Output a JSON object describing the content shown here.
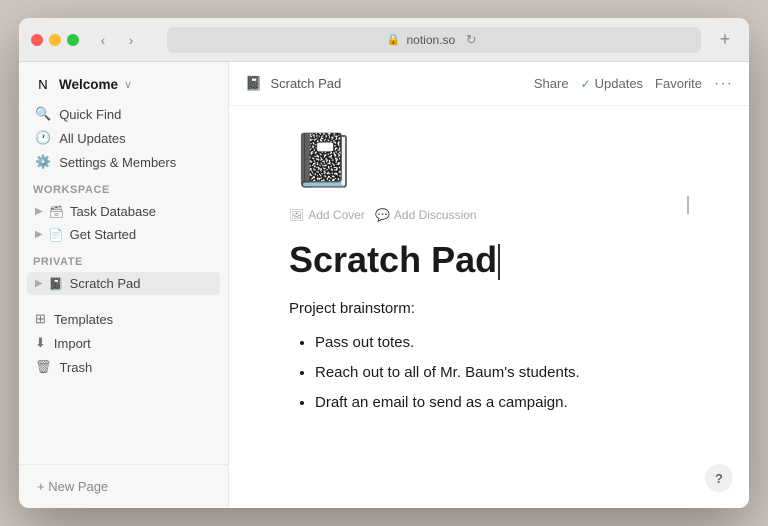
{
  "window": {
    "title": "notion.so"
  },
  "titlebar": {
    "address": "notion.so",
    "back_btn": "‹",
    "forward_btn": "›",
    "refresh_btn": "↻",
    "add_btn": "+"
  },
  "sidebar": {
    "workspace_name": "Welcome",
    "nav_items": [
      {
        "id": "quick-find",
        "icon": "🔍",
        "label": "Quick Find"
      },
      {
        "id": "all-updates",
        "icon": "🕐",
        "label": "All Updates"
      },
      {
        "id": "settings",
        "icon": "⚙️",
        "label": "Settings & Members"
      }
    ],
    "workspace_section": "WORKSPACE",
    "workspace_pages": [
      {
        "id": "task-db",
        "icon": "🗃",
        "label": "Task Database"
      },
      {
        "id": "get-started",
        "icon": "📄",
        "label": "Get Started"
      }
    ],
    "private_section": "PRIVATE",
    "private_pages": [
      {
        "id": "scratch-pad",
        "icon": "📓",
        "label": "Scratch Pad",
        "active": true
      }
    ],
    "bottom_items": [
      {
        "id": "templates",
        "icon": "⊞",
        "label": "Templates"
      },
      {
        "id": "import",
        "icon": "⬇",
        "label": "Import"
      },
      {
        "id": "trash",
        "icon": "🗑",
        "label": "Trash"
      }
    ],
    "new_page_label": "+ New Page"
  },
  "page": {
    "breadcrumb_icon": "📓",
    "breadcrumb_title": "Scratch Pad",
    "actions": {
      "share": "Share",
      "updates": "Updates",
      "updates_check": "✓",
      "favorite": "Favorite",
      "more": "···"
    },
    "cover_actions": {
      "add_cover": "Add Cover",
      "add_cover_icon": "🖼",
      "add_discussion": "Add Discussion",
      "add_discussion_icon": "💬"
    },
    "title": "Scratch Pad",
    "body_text": "Project brainstorm:",
    "bullets": [
      "Pass out totes.",
      "Reach out to all of Mr. Baum's students.",
      "Draft an email to send as a campaign."
    ],
    "help_btn": "?"
  }
}
